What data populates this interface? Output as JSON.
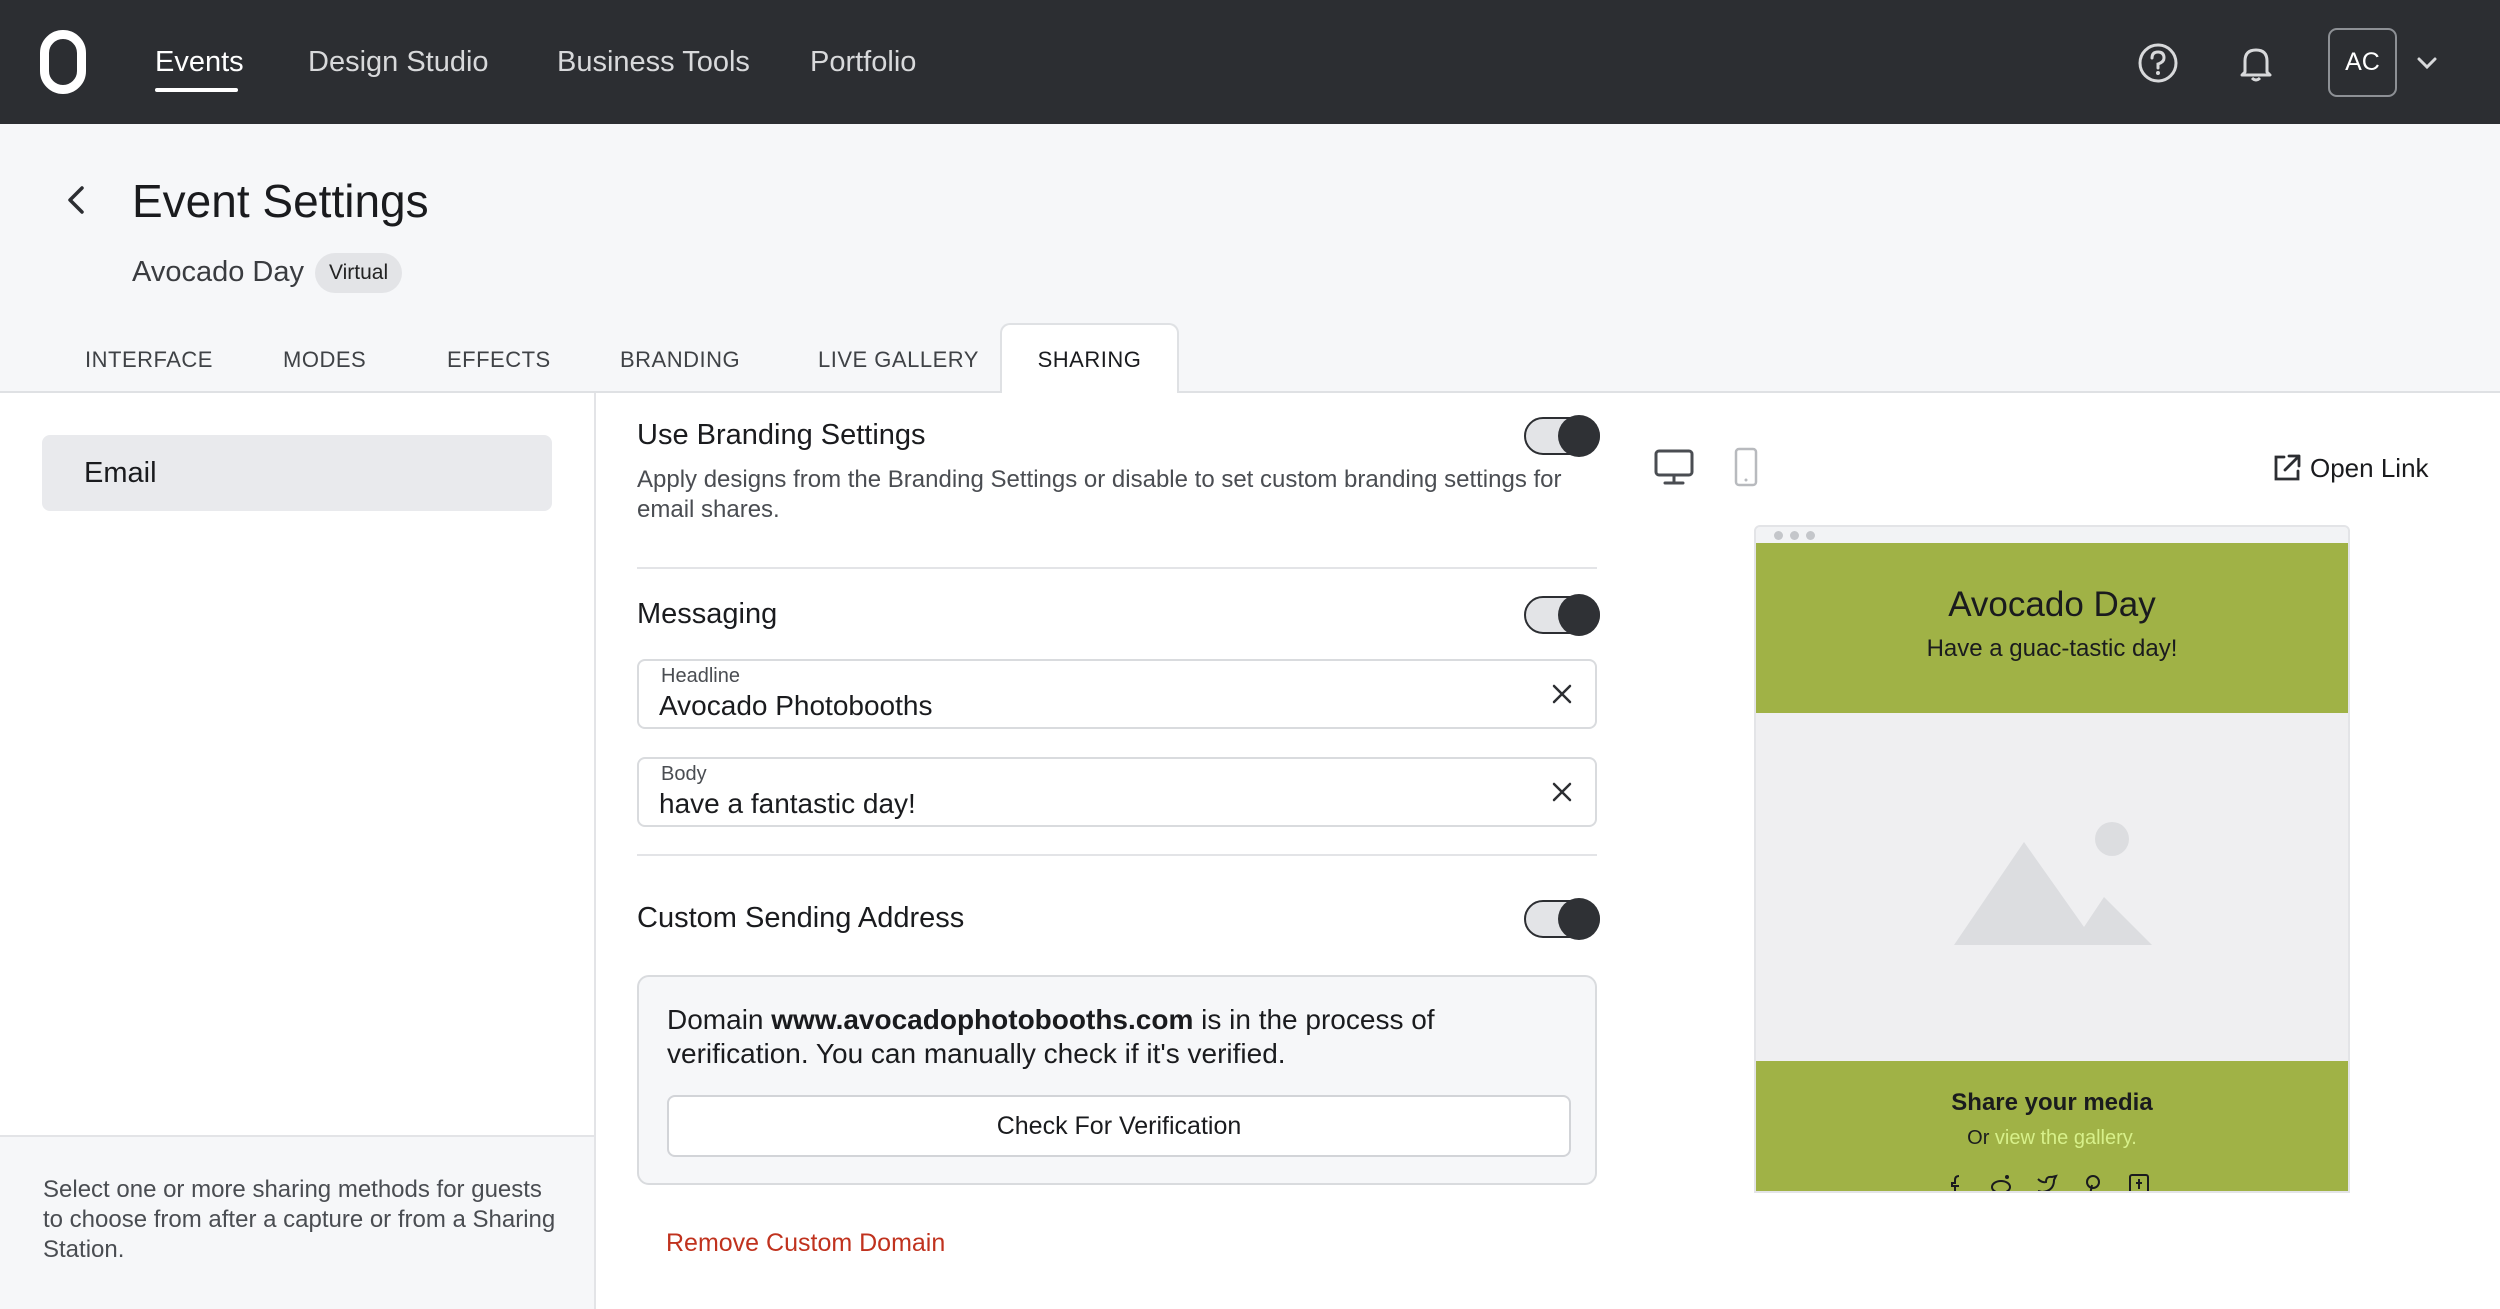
{
  "topnav": {
    "items": [
      {
        "label": "Events",
        "active": true
      },
      {
        "label": "Design Studio"
      },
      {
        "label": "Business Tools"
      },
      {
        "label": "Portfolio"
      }
    ],
    "avatar_initials": "AC"
  },
  "header": {
    "title": "Event Settings",
    "event_name": "Avocado Day",
    "badge": "Virtual"
  },
  "tabs": [
    "INTERFACE",
    "MODES",
    "EFFECTS",
    "BRANDING",
    "LIVE GALLERY",
    "SHARING"
  ],
  "active_tab": "SHARING",
  "sidebar": {
    "items": [
      {
        "label": "Email",
        "selected": true
      }
    ],
    "footer_text": "Select one or more sharing methods for guests to choose from after a capture or from a Sharing Station."
  },
  "branding": {
    "title": "Use Branding Settings",
    "description": "Apply designs from the Branding Settings or disable to set custom branding settings for email shares.",
    "enabled": true
  },
  "messaging": {
    "title": "Messaging",
    "enabled": true,
    "headline_label": "Headline",
    "headline_value": "Avocado Photobooths",
    "body_label": "Body",
    "body_value": "have a fantastic day!"
  },
  "custom_address": {
    "title": "Custom Sending Address",
    "enabled": true,
    "domain_prefix": "Domain",
    "domain": "www.avocadophotobooths.com",
    "domain_suffix": "is in the process of verification. You can manually check if it's verified.",
    "verify_label": "Check For Verification",
    "remove_label": "Remove Custom Domain"
  },
  "preview": {
    "open_link_label": "Open Link",
    "title": "Avocado Day",
    "subtitle": "Have a guac-tastic day!",
    "share_title": "Share your media",
    "or_text": "Or",
    "gallery_link": "view the gallery.",
    "accent_color": "#a0b246",
    "link_color": "#d7f08a",
    "social_icons": [
      "facebook-icon",
      "reddit-icon",
      "twitter-icon",
      "pinterest-icon",
      "tumblr-icon"
    ]
  },
  "colors": {
    "topbar": "#2c2e32",
    "danger": "#c0321e"
  }
}
